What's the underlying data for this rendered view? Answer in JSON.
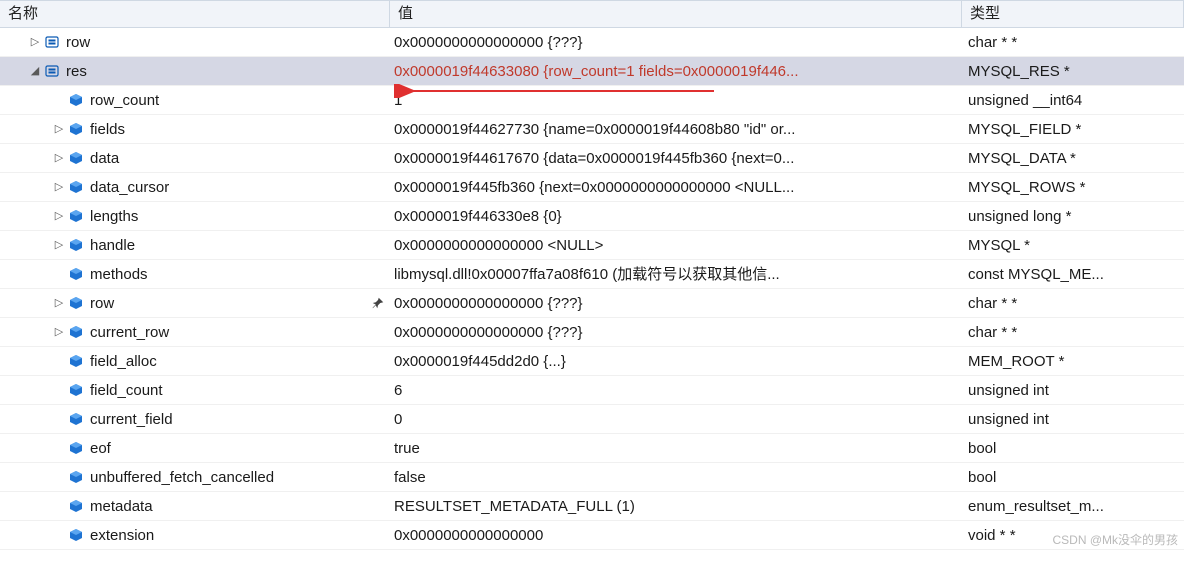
{
  "header": {
    "name": "名称",
    "value": "值",
    "type": "类型"
  },
  "rows": [
    {
      "depth": 1,
      "expander": "collapsed",
      "icon": "struct",
      "name": "row",
      "value": "0x0000000000000000 {???}",
      "type": "char * *",
      "selected": false,
      "pinned": false
    },
    {
      "depth": 1,
      "expander": "expanded",
      "icon": "struct",
      "name": "res",
      "value": "0x0000019f44633080 {row_count=1 fields=0x0000019f446...",
      "type": "MYSQL_RES *",
      "selected": true,
      "pinned": false
    },
    {
      "depth": 2,
      "expander": "none",
      "icon": "field",
      "name": "row_count",
      "value": "1",
      "type": "unsigned __int64",
      "selected": false,
      "pinned": false,
      "arrow_target": true
    },
    {
      "depth": 2,
      "expander": "collapsed",
      "icon": "field",
      "name": "fields",
      "value": "0x0000019f44627730 {name=0x0000019f44608b80 \"id\" or...",
      "type": "MYSQL_FIELD *",
      "selected": false,
      "pinned": false
    },
    {
      "depth": 2,
      "expander": "collapsed",
      "icon": "field",
      "name": "data",
      "value": "0x0000019f44617670 {data=0x0000019f445fb360 {next=0...",
      "type": "MYSQL_DATA *",
      "selected": false,
      "pinned": false
    },
    {
      "depth": 2,
      "expander": "collapsed",
      "icon": "field",
      "name": "data_cursor",
      "value": "0x0000019f445fb360 {next=0x0000000000000000 <NULL...",
      "type": "MYSQL_ROWS *",
      "selected": false,
      "pinned": false
    },
    {
      "depth": 2,
      "expander": "collapsed",
      "icon": "field",
      "name": "lengths",
      "value": "0x0000019f446330e8 {0}",
      "type": "unsigned long *",
      "selected": false,
      "pinned": false
    },
    {
      "depth": 2,
      "expander": "collapsed",
      "icon": "field",
      "name": "handle",
      "value": "0x0000000000000000 <NULL>",
      "type": "MYSQL *",
      "selected": false,
      "pinned": false
    },
    {
      "depth": 2,
      "expander": "none",
      "icon": "field",
      "name": "methods",
      "value": "libmysql.dll!0x00007ffa7a08f610 (加载符号以获取其他信...",
      "type": "const MYSQL_ME...",
      "selected": false,
      "pinned": false
    },
    {
      "depth": 2,
      "expander": "collapsed",
      "icon": "field",
      "name": "row",
      "value": "0x0000000000000000 {???}",
      "type": "char * *",
      "selected": false,
      "pinned": true
    },
    {
      "depth": 2,
      "expander": "collapsed",
      "icon": "field",
      "name": "current_row",
      "value": "0x0000000000000000 {???}",
      "type": "char * *",
      "selected": false,
      "pinned": false
    },
    {
      "depth": 2,
      "expander": "none",
      "icon": "field",
      "name": "field_alloc",
      "value": "0x0000019f445dd2d0 {...}",
      "type": "MEM_ROOT *",
      "selected": false,
      "pinned": false
    },
    {
      "depth": 2,
      "expander": "none",
      "icon": "field",
      "name": "field_count",
      "value": "6",
      "type": "unsigned int",
      "selected": false,
      "pinned": false
    },
    {
      "depth": 2,
      "expander": "none",
      "icon": "field",
      "name": "current_field",
      "value": "0",
      "type": "unsigned int",
      "selected": false,
      "pinned": false
    },
    {
      "depth": 2,
      "expander": "none",
      "icon": "field",
      "name": "eof",
      "value": "true",
      "type": "bool",
      "selected": false,
      "pinned": false
    },
    {
      "depth": 2,
      "expander": "none",
      "icon": "field",
      "name": "unbuffered_fetch_cancelled",
      "value": "false",
      "type": "bool",
      "selected": false,
      "pinned": false
    },
    {
      "depth": 2,
      "expander": "none",
      "icon": "field",
      "name": "metadata",
      "value": "RESULTSET_METADATA_FULL (1)",
      "type": "enum_resultset_m...",
      "selected": false,
      "pinned": false
    },
    {
      "depth": 2,
      "expander": "none",
      "icon": "field",
      "name": "extension",
      "value": "0x0000000000000000",
      "type": "void * *",
      "selected": false,
      "pinned": false
    }
  ],
  "watermark": "CSDN @Mk没伞的男孩"
}
